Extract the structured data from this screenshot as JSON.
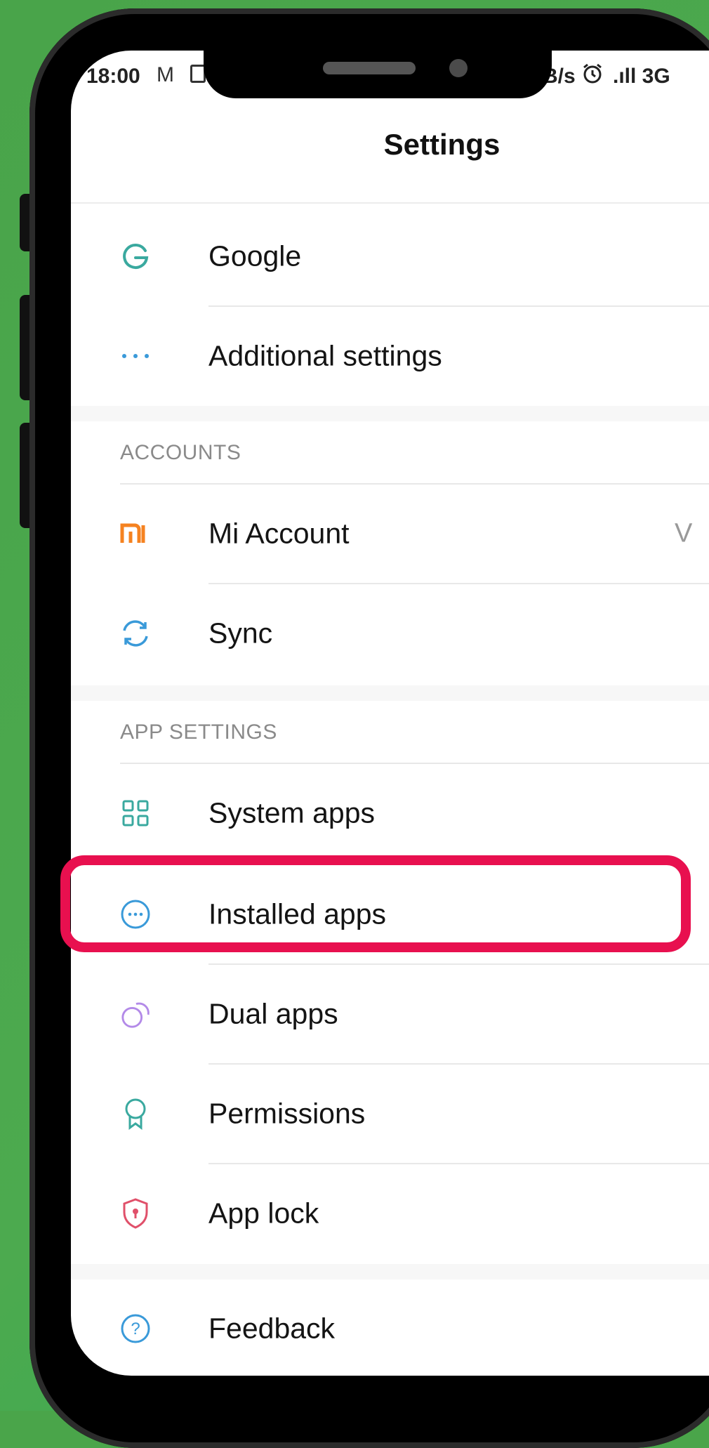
{
  "status_bar": {
    "time": "18:00",
    "gmail_icon": "M",
    "speed": "B/s",
    "alarm_icon": "alarm-clock",
    "signal": ".ıll 3G"
  },
  "header": {
    "title": "Settings"
  },
  "rows": {
    "google": {
      "label": "Google",
      "icon": "G",
      "icon_color": "#3aa99f"
    },
    "additional": {
      "label": "Additional settings",
      "icon": "···",
      "icon_color": "#3a9ad9"
    },
    "mi_account": {
      "label": "Mi Account",
      "value": "V",
      "icon": "mi",
      "icon_color": "#f58220"
    },
    "sync": {
      "label": "Sync",
      "icon": "sync-icon",
      "icon_color": "#3a9ad9"
    },
    "system_apps": {
      "label": "System apps",
      "icon": "grid-icon",
      "icon_color": "#3aa99f"
    },
    "installed_apps": {
      "label": "Installed apps",
      "icon": "···",
      "icon_color": "#3a9ad9"
    },
    "dual_apps": {
      "label": "Dual apps",
      "icon": "dual-circles-icon",
      "icon_color": "#b38ae8"
    },
    "permissions": {
      "label": "Permissions",
      "icon": "badge-icon",
      "icon_color": "#3aa99f"
    },
    "app_lock": {
      "label": "App lock",
      "icon": "shield-icon",
      "icon_color": "#e0506a"
    },
    "feedback": {
      "label": "Feedback",
      "icon": "?",
      "icon_color": "#3a9ad9"
    }
  },
  "sections": {
    "accounts": "ACCOUNTS",
    "app_settings": "APP SETTINGS"
  },
  "colors": {
    "background_green": "#4aa54a",
    "highlight": "#e8104f"
  }
}
